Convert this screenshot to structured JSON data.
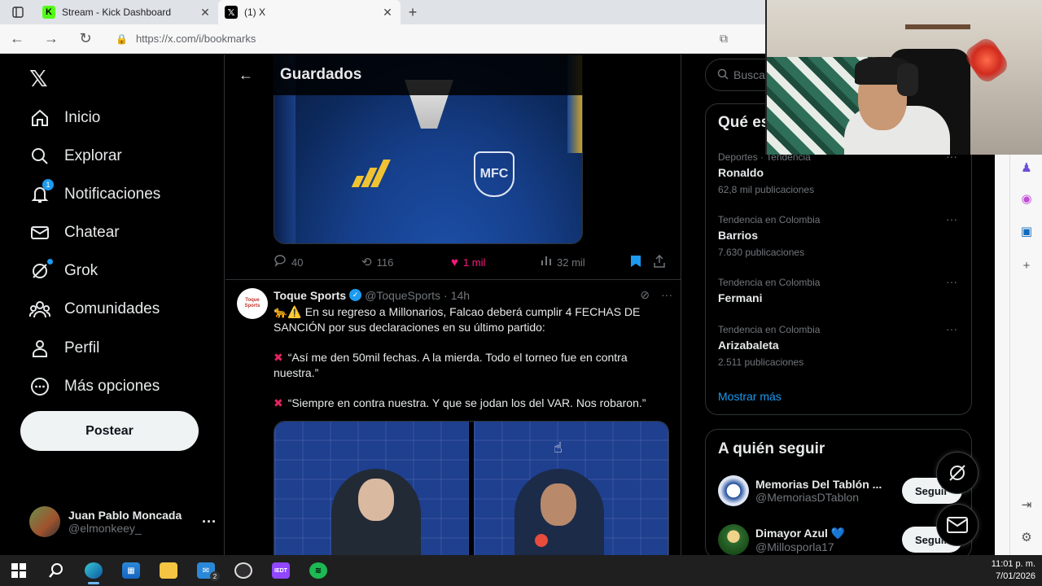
{
  "browser": {
    "tabs": [
      {
        "title": "Stream - Kick Dashboard",
        "favicon": "kick-icon",
        "active": false
      },
      {
        "title": "(1) X",
        "favicon": "x-icon",
        "active": true
      }
    ],
    "url": "https://x.com/i/bookmarks"
  },
  "sidebar": {
    "items": [
      {
        "label": "Inicio",
        "icon": "home-icon"
      },
      {
        "label": "Explorar",
        "icon": "search-icon"
      },
      {
        "label": "Notificaciones",
        "icon": "bell-icon",
        "badge": "1"
      },
      {
        "label": "Chatear",
        "icon": "mail-icon"
      },
      {
        "label": "Grok",
        "icon": "grok-icon"
      },
      {
        "label": "Comunidades",
        "icon": "communities-icon"
      },
      {
        "label": "Perfil",
        "icon": "person-icon"
      },
      {
        "label": "Más opciones",
        "icon": "more-icon"
      }
    ],
    "post_button": "Postear",
    "account": {
      "name": "Juan Pablo Moncada",
      "handle": "@elmonkeey_"
    }
  },
  "main": {
    "title": "Guardados",
    "tweet1": {
      "crest_text": "MFC",
      "replies": "40",
      "retweets": "116",
      "likes": "1 mil",
      "views": "32 mil"
    },
    "tweet2": {
      "avatar_text": "Toque Sports",
      "name": "Toque Sports",
      "handle": "@ToqueSports",
      "separator": "·",
      "time": "14h",
      "line1": "🐆⚠️ En su regreso a Millonarios, Falcao deberá cumplir 4 FECHAS DE SANCIÓN por sus declaraciones en su último partido:",
      "quote1": "“Así me den 50mil fechas. A la mierda. Todo el torneo fue en contra nuestra.”",
      "quote2": "“Siempre en contra nuestra. Y que se jodan los del VAR. Nos robaron.”"
    }
  },
  "right": {
    "search_placeholder": "Buscar",
    "trends_title": "Qué está pasando",
    "trends": [
      {
        "context": "Deportes · Tendencia",
        "name": "Ronaldo",
        "count": "62,8 mil publicaciones"
      },
      {
        "context": "Tendencia en Colombia",
        "name": "Barrios",
        "count": "7.630 publicaciones"
      },
      {
        "context": "Tendencia en Colombia",
        "name": "Fermani",
        "count": ""
      },
      {
        "context": "Tendencia en Colombia",
        "name": "Arizabaleta",
        "count": "2.511 publicaciones"
      }
    ],
    "show_more": "Mostrar más",
    "follow_title": "A quién seguir",
    "follow": [
      {
        "name": "Memorias Del Tablón ...",
        "handle": "@MemoriasDTablon",
        "button": "Seguir"
      },
      {
        "name": "Dimayor Azul 💙",
        "handle": "@Millosporla17",
        "button": "Seguir"
      }
    ]
  },
  "taskbar": {
    "time": "11:01 p. m.",
    "date": "7/01/2026",
    "mail_count": "2",
    "app_label": "IEDT"
  },
  "colors": {
    "accent": "#1d9bf0",
    "like": "#f91880",
    "bg": "#000000"
  }
}
